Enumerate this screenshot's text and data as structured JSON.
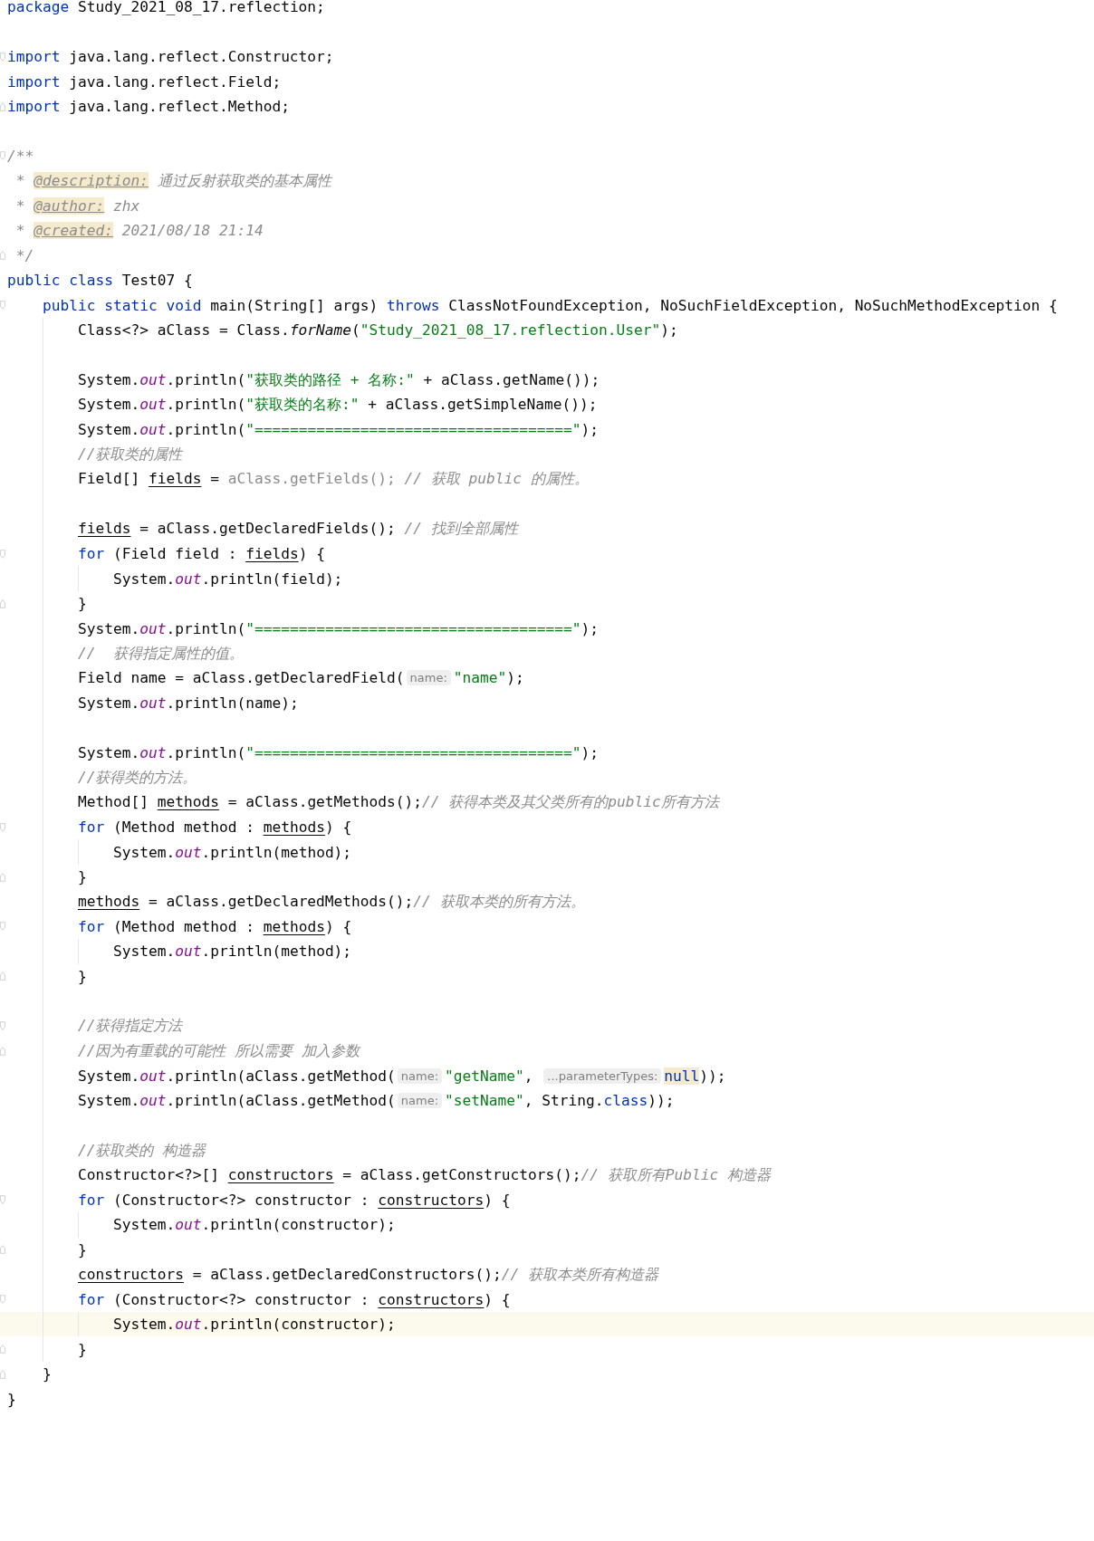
{
  "editor": {
    "lines": [
      {
        "kind": "plain",
        "current": false,
        "tokens": [
          {
            "text": "package",
            "kind": "keyword"
          },
          {
            "text": " Study_2021_08_17.reflection;",
            "kind": "plain"
          }
        ]
      },
      {
        "kind": "plain",
        "current": false
      },
      {
        "kind": "fold-start",
        "current": false,
        "tokens": [
          {
            "text": "import",
            "kind": "keyword"
          },
          {
            "text": " java.lang.reflect.Constructor;",
            "kind": "plain"
          }
        ]
      },
      {
        "kind": "plain",
        "current": false,
        "tokens": [
          {
            "text": "import",
            "kind": "keyword"
          },
          {
            "text": " java.lang.reflect.Field;",
            "kind": "plain"
          }
        ]
      },
      {
        "kind": "fold-end",
        "current": false,
        "tokens": [
          {
            "text": "import",
            "kind": "keyword"
          },
          {
            "text": " java.lang.reflect.Method;",
            "kind": "plain"
          }
        ]
      },
      {
        "kind": "plain",
        "current": false
      },
      {
        "kind": "fold-start",
        "current": false,
        "tokens": [
          {
            "text": "/**",
            "kind": "doc"
          }
        ]
      },
      {
        "kind": "plain",
        "current": false,
        "tokens": [
          {
            "text": " * ",
            "kind": "doc"
          },
          {
            "text": "@description:",
            "kind": "doc-tag"
          },
          {
            "text": " 通过反射获取类的基本属性",
            "kind": "doc"
          }
        ]
      },
      {
        "kind": "plain",
        "current": false,
        "tokens": [
          {
            "text": " * ",
            "kind": "doc"
          },
          {
            "text": "@author:",
            "kind": "doc-tag"
          },
          {
            "text": " zhx",
            "kind": "doc"
          }
        ]
      },
      {
        "kind": "plain",
        "current": false,
        "tokens": [
          {
            "text": " * ",
            "kind": "doc"
          },
          {
            "text": "@created:",
            "kind": "doc-tag"
          },
          {
            "text": " 2021/08/18 21:14",
            "kind": "doc"
          }
        ]
      },
      {
        "kind": "fold-end",
        "current": false,
        "tokens": [
          {
            "text": " */",
            "kind": "doc"
          }
        ]
      },
      {
        "kind": "plain",
        "current": false,
        "tokens": [
          {
            "text": "public class",
            "kind": "keyword"
          },
          {
            "text": " Test07 {",
            "kind": "plain"
          }
        ]
      },
      {
        "kind": "fold-start",
        "current": false,
        "tokens": [
          {
            "text": "    public static void",
            "kind": "keyword"
          },
          {
            "text": " main(String[] args) ",
            "kind": "plain"
          },
          {
            "text": "throws",
            "kind": "keyword"
          },
          {
            "text": " ClassNotFoundException, NoSuchFieldException, NoSuchMethodException {",
            "kind": "plain"
          }
        ]
      },
      {
        "kind": "plain",
        "current": false,
        "tokens": [
          {
            "text": "        Class<?> aClass = Class.",
            "kind": "plain"
          },
          {
            "text": "forName",
            "kind": "static-method"
          },
          {
            "text": "(",
            "kind": "plain"
          },
          {
            "text": "\"Study_2021_08_17.reflection.User\"",
            "kind": "string"
          },
          {
            "text": ");",
            "kind": "plain"
          }
        ]
      },
      {
        "kind": "plain",
        "current": false
      },
      {
        "kind": "plain",
        "current": false,
        "tokens": [
          {
            "text": "        System.",
            "kind": "plain"
          },
          {
            "text": "out",
            "kind": "static-field"
          },
          {
            "text": ".println(",
            "kind": "plain"
          },
          {
            "text": "\"获取类的路径 + 名称:\"",
            "kind": "string"
          },
          {
            "text": " + aClass.getName());",
            "kind": "plain"
          }
        ]
      },
      {
        "kind": "plain",
        "current": false,
        "tokens": [
          {
            "text": "        System.",
            "kind": "plain"
          },
          {
            "text": "out",
            "kind": "static-field"
          },
          {
            "text": ".println(",
            "kind": "plain"
          },
          {
            "text": "\"获取类的名称:\"",
            "kind": "string"
          },
          {
            "text": " + aClass.getSimpleName());",
            "kind": "plain"
          }
        ]
      },
      {
        "kind": "plain",
        "current": false,
        "tokens": [
          {
            "text": "        System.",
            "kind": "plain"
          },
          {
            "text": "out",
            "kind": "static-field"
          },
          {
            "text": ".println(",
            "kind": "plain"
          },
          {
            "text": "\"====================================\"",
            "kind": "string"
          },
          {
            "text": ");",
            "kind": "plain"
          }
        ]
      },
      {
        "kind": "plain",
        "current": false,
        "tokens": [
          {
            "text": "        //获取类的属性",
            "kind": "comment"
          }
        ]
      },
      {
        "kind": "plain",
        "current": false,
        "tokens": [
          {
            "text": "        Field[] ",
            "kind": "plain"
          },
          {
            "text": "fields",
            "kind": "reassigned"
          },
          {
            "text": " = ",
            "kind": "plain"
          },
          {
            "text": "aClass.getFields();",
            "kind": "unused"
          },
          {
            "text": " // 获取 public 的属性。",
            "kind": "comment"
          }
        ]
      },
      {
        "kind": "plain",
        "current": false
      },
      {
        "kind": "plain",
        "current": false,
        "tokens": [
          {
            "text": "        fields",
            "kind": "reassigned"
          },
          {
            "text": " = aClass.getDeclaredFields(); ",
            "kind": "plain"
          },
          {
            "text": "// 找到全部属性",
            "kind": "comment"
          }
        ]
      },
      {
        "kind": "fold-start",
        "current": false,
        "tokens": [
          {
            "text": "        for",
            "kind": "keyword"
          },
          {
            "text": " (Field field : ",
            "kind": "plain"
          },
          {
            "text": "fields",
            "kind": "reassigned"
          },
          {
            "text": ") {",
            "kind": "plain"
          }
        ]
      },
      {
        "kind": "plain",
        "current": false,
        "tokens": [
          {
            "text": "            System.",
            "kind": "plain"
          },
          {
            "text": "out",
            "kind": "static-field"
          },
          {
            "text": ".println(field);",
            "kind": "plain"
          }
        ]
      },
      {
        "kind": "fold-end",
        "current": false,
        "tokens": [
          {
            "text": "        }",
            "kind": "plain"
          }
        ]
      },
      {
        "kind": "plain",
        "current": false,
        "tokens": [
          {
            "text": "        System.",
            "kind": "plain"
          },
          {
            "text": "out",
            "kind": "static-field"
          },
          {
            "text": ".println(",
            "kind": "plain"
          },
          {
            "text": "\"====================================\"",
            "kind": "string"
          },
          {
            "text": ");",
            "kind": "plain"
          }
        ]
      },
      {
        "kind": "plain",
        "current": false,
        "tokens": [
          {
            "text": "        //  获得指定属性的值。",
            "kind": "comment"
          }
        ]
      },
      {
        "kind": "plain",
        "current": false,
        "tokens": [
          {
            "text": "        Field name = aClass.getDeclaredField(",
            "kind": "plain"
          },
          {
            "text": "name:",
            "kind": "hint"
          },
          {
            "text": "\"name\"",
            "kind": "string"
          },
          {
            "text": ");",
            "kind": "plain"
          }
        ]
      },
      {
        "kind": "plain",
        "current": false,
        "tokens": [
          {
            "text": "        System.",
            "kind": "plain"
          },
          {
            "text": "out",
            "kind": "static-field"
          },
          {
            "text": ".println(name);",
            "kind": "plain"
          }
        ]
      },
      {
        "kind": "plain",
        "current": false
      },
      {
        "kind": "plain",
        "current": false,
        "tokens": [
          {
            "text": "        System.",
            "kind": "plain"
          },
          {
            "text": "out",
            "kind": "static-field"
          },
          {
            "text": ".println(",
            "kind": "plain"
          },
          {
            "text": "\"====================================\"",
            "kind": "string"
          },
          {
            "text": ");",
            "kind": "plain"
          }
        ]
      },
      {
        "kind": "plain",
        "current": false,
        "tokens": [
          {
            "text": "        //获得类的方法。",
            "kind": "comment"
          }
        ]
      },
      {
        "kind": "plain",
        "current": false,
        "tokens": [
          {
            "text": "        Method[] ",
            "kind": "plain"
          },
          {
            "text": "methods",
            "kind": "reassigned"
          },
          {
            "text": " = aClass.getMethods();",
            "kind": "plain"
          },
          {
            "text": "// 获得本类及其父类所有的public所有方法",
            "kind": "comment"
          }
        ]
      },
      {
        "kind": "fold-start",
        "current": false,
        "tokens": [
          {
            "text": "        for",
            "kind": "keyword"
          },
          {
            "text": " (Method method : ",
            "kind": "plain"
          },
          {
            "text": "methods",
            "kind": "reassigned"
          },
          {
            "text": ") {",
            "kind": "plain"
          }
        ]
      },
      {
        "kind": "plain",
        "current": false,
        "tokens": [
          {
            "text": "            System.",
            "kind": "plain"
          },
          {
            "text": "out",
            "kind": "static-field"
          },
          {
            "text": ".println(method);",
            "kind": "plain"
          }
        ]
      },
      {
        "kind": "fold-end",
        "current": false,
        "tokens": [
          {
            "text": "        }",
            "kind": "plain"
          }
        ]
      },
      {
        "kind": "plain",
        "current": false,
        "tokens": [
          {
            "text": "        methods",
            "kind": "reassigned"
          },
          {
            "text": " = aClass.getDeclaredMethods();",
            "kind": "plain"
          },
          {
            "text": "// 获取本类的所有方法。",
            "kind": "comment"
          }
        ]
      },
      {
        "kind": "fold-start",
        "current": false,
        "tokens": [
          {
            "text": "        for",
            "kind": "keyword"
          },
          {
            "text": " (Method method : ",
            "kind": "plain"
          },
          {
            "text": "methods",
            "kind": "reassigned"
          },
          {
            "text": ") {",
            "kind": "plain"
          }
        ]
      },
      {
        "kind": "plain",
        "current": false,
        "tokens": [
          {
            "text": "            System.",
            "kind": "plain"
          },
          {
            "text": "out",
            "kind": "static-field"
          },
          {
            "text": ".println(method);",
            "kind": "plain"
          }
        ]
      },
      {
        "kind": "fold-end",
        "current": false,
        "tokens": [
          {
            "text": "        }",
            "kind": "plain"
          }
        ]
      },
      {
        "kind": "plain",
        "current": false
      },
      {
        "kind": "fold-start",
        "current": false,
        "tokens": [
          {
            "text": "        //获得指定方法",
            "kind": "comment"
          }
        ]
      },
      {
        "kind": "fold-end",
        "current": false,
        "tokens": [
          {
            "text": "        //因为有重载的可能性 所以需要 加入参数",
            "kind": "comment"
          }
        ]
      },
      {
        "kind": "plain",
        "current": false,
        "tokens": [
          {
            "text": "        System.",
            "kind": "plain"
          },
          {
            "text": "out",
            "kind": "static-field"
          },
          {
            "text": ".println(aClass.getMethod(",
            "kind": "plain"
          },
          {
            "text": "name:",
            "kind": "hint"
          },
          {
            "text": "\"getName\"",
            "kind": "string"
          },
          {
            "text": ", ",
            "kind": "plain"
          },
          {
            "text": "...parameterTypes:",
            "kind": "hint"
          },
          {
            "text": "null",
            "kind": "matched-keyword"
          },
          {
            "text": "));",
            "kind": "plain"
          }
        ]
      },
      {
        "kind": "plain",
        "current": false,
        "tokens": [
          {
            "text": "        System.",
            "kind": "plain"
          },
          {
            "text": "out",
            "kind": "static-field"
          },
          {
            "text": ".println(aClass.getMethod(",
            "kind": "plain"
          },
          {
            "text": "name:",
            "kind": "hint"
          },
          {
            "text": "\"setName\"",
            "kind": "string"
          },
          {
            "text": ", String.",
            "kind": "plain"
          },
          {
            "text": "class",
            "kind": "keyword"
          },
          {
            "text": "));",
            "kind": "plain"
          }
        ]
      },
      {
        "kind": "plain",
        "current": false
      },
      {
        "kind": "plain",
        "current": false,
        "tokens": [
          {
            "text": "        //获取类的 构造器",
            "kind": "comment"
          }
        ]
      },
      {
        "kind": "plain",
        "current": false,
        "tokens": [
          {
            "text": "        Constructor<?>[] ",
            "kind": "plain"
          },
          {
            "text": "constructors",
            "kind": "reassigned"
          },
          {
            "text": " = aClass.getConstructors();",
            "kind": "plain"
          },
          {
            "text": "// 获取所有Public 构造器",
            "kind": "comment"
          }
        ]
      },
      {
        "kind": "fold-start",
        "current": false,
        "tokens": [
          {
            "text": "        for",
            "kind": "keyword"
          },
          {
            "text": " (Constructor<?> constructor : ",
            "kind": "plain"
          },
          {
            "text": "constructors",
            "kind": "reassigned"
          },
          {
            "text": ") {",
            "kind": "plain"
          }
        ]
      },
      {
        "kind": "plain",
        "current": false,
        "tokens": [
          {
            "text": "            System.",
            "kind": "plain"
          },
          {
            "text": "out",
            "kind": "static-field"
          },
          {
            "text": ".println(constructor);",
            "kind": "plain"
          }
        ]
      },
      {
        "kind": "fold-end",
        "current": false,
        "tokens": [
          {
            "text": "        }",
            "kind": "plain"
          }
        ]
      },
      {
        "kind": "plain",
        "current": false,
        "tokens": [
          {
            "text": "        constructors",
            "kind": "reassigned"
          },
          {
            "text": " = aClass.getDeclaredConstructors();",
            "kind": "plain"
          },
          {
            "text": "// 获取本类所有构造器",
            "kind": "comment"
          }
        ]
      },
      {
        "kind": "fold-start",
        "current": false,
        "tokens": [
          {
            "text": "        for",
            "kind": "keyword"
          },
          {
            "text": " (Constructor<?> constructor : ",
            "kind": "plain"
          },
          {
            "text": "constructors",
            "kind": "reassigned"
          },
          {
            "text": ") {",
            "kind": "plain"
          }
        ]
      },
      {
        "kind": "plain",
        "current": true,
        "tokens": [
          {
            "text": "            System.",
            "kind": "plain"
          },
          {
            "text": "out",
            "kind": "static-field"
          },
          {
            "text": ".println(constructor);",
            "kind": "plain"
          }
        ]
      },
      {
        "kind": "fold-end",
        "current": false,
        "tokens": [
          {
            "text": "        }",
            "kind": "plain"
          }
        ]
      },
      {
        "kind": "fold-end",
        "current": false,
        "tokens": [
          {
            "text": "    }",
            "kind": "plain"
          }
        ]
      },
      {
        "kind": "plain",
        "current": false,
        "tokens": [
          {
            "text": "}",
            "kind": "plain"
          }
        ]
      }
    ]
  }
}
